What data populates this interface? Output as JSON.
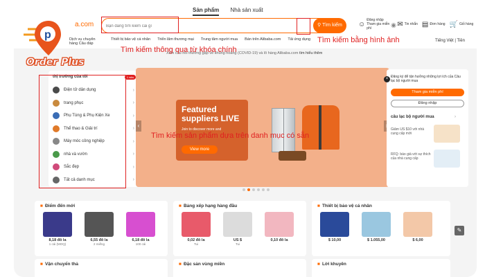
{
  "header": {
    "tabs": [
      "Sản phẩm",
      "Nhà sản xuất"
    ],
    "brand_suffix": "a.com",
    "search_placeholder": "Bạn đang tìm kiếm cái gì",
    "search_button": "Tìm kiếm",
    "icons": [
      {
        "icon": "user-icon",
        "label": "Đăng nhập Tham gia miễn phí"
      },
      {
        "icon": "message-icon",
        "label": "Tin nhắn"
      },
      {
        "icon": "orders-icon",
        "label": "Đơn hàng"
      },
      {
        "icon": "cart-icon",
        "label": "Giỏ hàng"
      }
    ],
    "catnav": [
      "Dịch vụ chuyên hàng Câu đáp",
      "Thiết bị bảo vệ cá nhân",
      "Triển lãm thương mại",
      "Trung tâm người mua",
      "Bán trên Alibaba.com",
      "Tải ứng dụng"
    ],
    "language": "Tiếng Việt",
    "currency": "Tiền",
    "notice": "Xem câu hỏi thường gặp về khủng hoảng (COVID-19) và lô hàng Alibaba.com",
    "notice_link": "tìm hiểu thêm"
  },
  "logo": {
    "text": "Order Plus"
  },
  "annotations": {
    "search_label": "Tìm kiếm thông qua từ khóa chính",
    "image_label": "Tìm kiếm bằng hình ảnh",
    "category_label": "Tìm kiếm sản phẩm dựa trên danh mục có sẵn"
  },
  "sidebar": {
    "title": "thị trường của tôi",
    "badge": "1 wks",
    "items": [
      {
        "label": "Điện tử dân dụng",
        "color": "#4a4a4a"
      },
      {
        "label": "trang phục",
        "color": "#c98a3e"
      },
      {
        "label": "Phụ Tùng & Phụ Kiện Xe",
        "color": "#3a6db5"
      },
      {
        "label": "Thể thao & Giải trí",
        "color": "#e07a2a"
      },
      {
        "label": "Máy móc công nghiệp",
        "color": "#888888"
      },
      {
        "label": "nhà và vườn",
        "color": "#4a9a4a"
      },
      {
        "label": "Sắc đẹp",
        "color": "#d04a7a"
      },
      {
        "label": "Tất cả danh mục",
        "color": "#666666"
      }
    ]
  },
  "banner": {
    "title": "Featured suppliers LIVE",
    "subtitle": "Join to discover more and",
    "button": "View more"
  },
  "right_panel": {
    "intro": "Đăng ký để tận hưởng những lợi ích của Câu lạc bộ người mua",
    "join_button": "Tham gia miễn phí",
    "login_button": "Đăng nhập",
    "club_title": "câu lạc bộ người mua",
    "promos": [
      {
        "text": "Giảm US $10 với nhà cung cấp mới"
      },
      {
        "text": "RFQ: báo giá với sự thích của nhà cung cấp"
      }
    ]
  },
  "cards": [
    {
      "title": "Điểm đến mới",
      "products": [
        {
          "price": "8,18 đô la",
          "unit": "1 cái (MOQ)",
          "color": "#3a3a8a"
        },
        {
          "price": "6,55 đô la",
          "unit": "2 miếng",
          "color": "#555555"
        },
        {
          "price": "6,18 đô la",
          "unit": "100 cái",
          "color": "#d74fd0"
        }
      ]
    },
    {
      "title": "Bảng xếp hạng hàng đầu",
      "products": [
        {
          "price": "0,02 đô la",
          "unit": "Tui",
          "color": "#e85a6a"
        },
        {
          "price": "US $",
          "unit": "Tui",
          "color": "#dcdcdc"
        },
        {
          "price": "0,10 đô la",
          "unit": "",
          "color": "#f2b7c0"
        }
      ]
    },
    {
      "title": "Thiết bị bảo vệ cá nhân",
      "products": [
        {
          "price": "$ 10,00",
          "unit": "",
          "color": "#2a4a9a"
        },
        {
          "price": "$ 1.055,00",
          "unit": "",
          "color": "#9ac7e0"
        },
        {
          "price": "$ 6,00",
          "unit": "",
          "color": "#f3c8a8"
        }
      ]
    }
  ],
  "bottom": [
    "Vận chuyển thả",
    "Đặc sản vùng miền",
    "Lời khuyên"
  ]
}
